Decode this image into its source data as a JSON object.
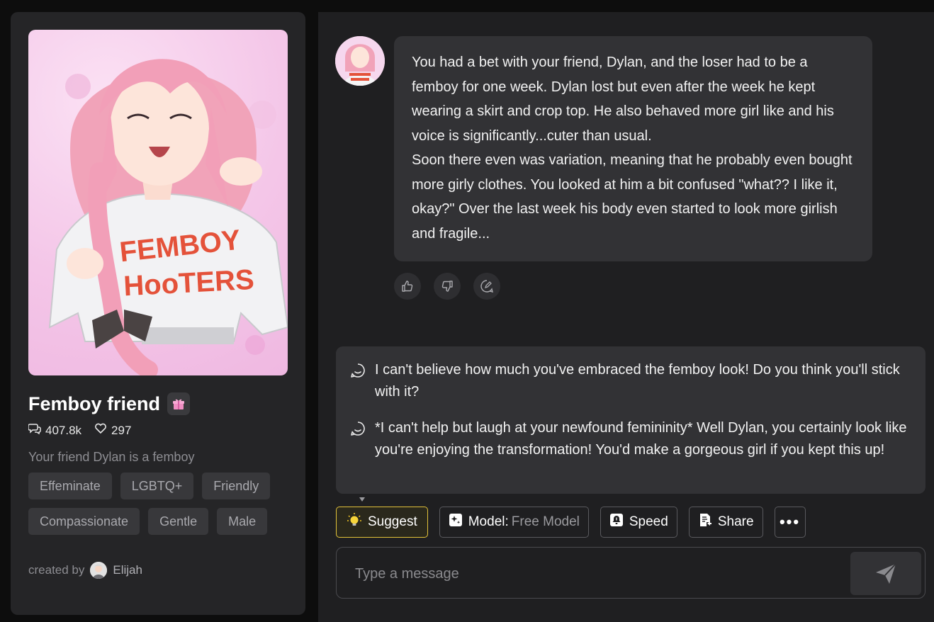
{
  "character": {
    "name": "Femboy friend",
    "chats_count": "407.8k",
    "likes_count": "297",
    "description": "Your friend Dylan is a femboy",
    "tags": [
      "Effeminate",
      "LGBTQ+",
      "Friendly",
      "Compassionate",
      "Gentle",
      "Male"
    ],
    "created_by_label": "created by",
    "creator": "Elijah",
    "shirt_text_line1": "FEMBOY",
    "shirt_text_line2": "HooTERS"
  },
  "message": {
    "paragraph1": "You had a bet with your friend, Dylan, and the loser had to be a femboy for one week. Dylan lost but even after the week he kept wearing a skirt and crop top. He also behaved more girl like and his voice is significantly...cuter than usual.",
    "paragraph2": "Soon there even was variation, meaning that he probably even bought more girly clothes. You looked at him a bit confused \"what?? I like it, okay?\" Over the last week his body even started to look more girlish and fragile..."
  },
  "suggestions": [
    "I can't believe how much you've embraced the femboy look! Do you think you'll stick with it?",
    "*I can't help but laugh at your newfound femininity* Well Dylan, you certainly look like you're enjoying the transformation! You'd make a gorgeous girl if you kept this up!"
  ],
  "toolbar": {
    "suggest_label": "Suggest",
    "model_label": "Model:",
    "model_value": "Free Model",
    "speed_label": "Speed",
    "share_label": "Share",
    "more_label": "•••"
  },
  "composer": {
    "placeholder": "Type a message"
  },
  "colors": {
    "suggest_border": "#e2c23a",
    "card_bg": "#252527",
    "bubble_bg": "#323235"
  }
}
